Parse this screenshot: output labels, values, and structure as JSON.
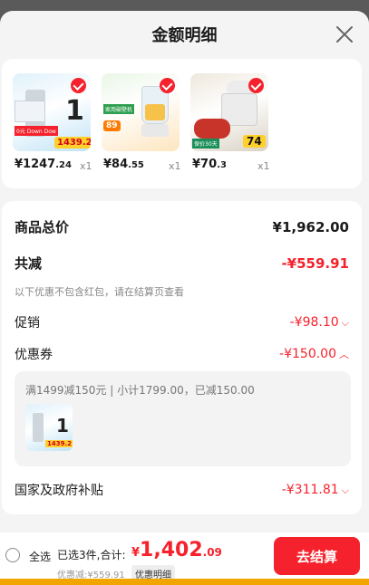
{
  "header": {
    "title": "金额明细"
  },
  "products": [
    {
      "price_int": "¥1247",
      "price_dec": ".24",
      "qty": "x1",
      "badge_top": "0元 Down Dow",
      "badge_price": "1439.2",
      "big": "1",
      "theme": "#49b7e8"
    },
    {
      "price_int": "¥84",
      "price_dec": ".55",
      "qty": "x1",
      "badge_top": "家用破壁机",
      "badge_price": "89",
      "big": "",
      "theme": "#f3c060"
    },
    {
      "price_int": "¥70",
      "price_dec": ".3",
      "qty": "x1",
      "badge_top": "保价30天",
      "badge_price": "74",
      "big": "",
      "theme": "#8a8a80"
    }
  ],
  "summary": {
    "goods_total_label": "商品总价",
    "goods_total_value": "¥1,962.00",
    "reduce_label": "共减",
    "reduce_value": "-¥559.91",
    "reduce_note": "以下优惠不包含红包，请在结算页查看",
    "promo_label": "促销",
    "promo_value": "-¥98.10",
    "coupon_label": "优惠券",
    "coupon_value": "-¥150.00",
    "coupon_detail": "满1499减150元 | 小计1799.00，已减150.00",
    "subsidy_label": "国家及政府补贴",
    "subsidy_value": "-¥311.81"
  },
  "footer": {
    "select_all": "全选",
    "selected_summary": "已选3件,合计:",
    "total_yen": "¥",
    "total_int": "1,402",
    "total_dec": ".09",
    "discount_text": "优惠减:¥559.91",
    "detail_link": "优惠明细",
    "checkout": "去结算"
  },
  "colors": {
    "accent": "#f5222d",
    "background": "#f4f4f4",
    "card": "#ffffff"
  }
}
